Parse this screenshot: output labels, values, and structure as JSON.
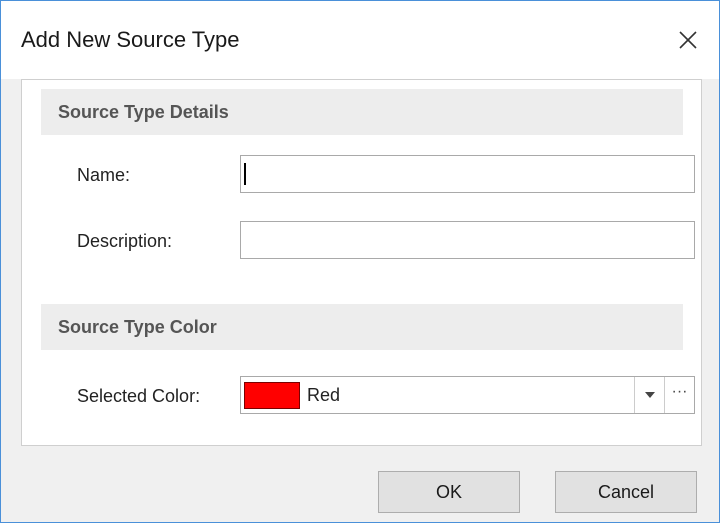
{
  "dialog": {
    "title": "Add New Source Type"
  },
  "details_section": {
    "header": "Source Type Details",
    "name_label": "Name:",
    "name_value": "",
    "description_label": "Description:",
    "description_value": ""
  },
  "color_section": {
    "header": "Source Type Color",
    "selected_label": "Selected Color:",
    "selected_color_name": "Red",
    "selected_color_hex": "#ff0000",
    "more_glyph": "···"
  },
  "buttons": {
    "ok": "OK",
    "cancel": "Cancel"
  },
  "icons": {
    "close": "close-icon",
    "dropdown": "chevron-down-icon",
    "more": "ellipsis-icon"
  },
  "colors": {
    "border_accent": "#4a90d9",
    "dialog_bg": "#f0f0f0",
    "section_header_bg": "#ededed"
  }
}
